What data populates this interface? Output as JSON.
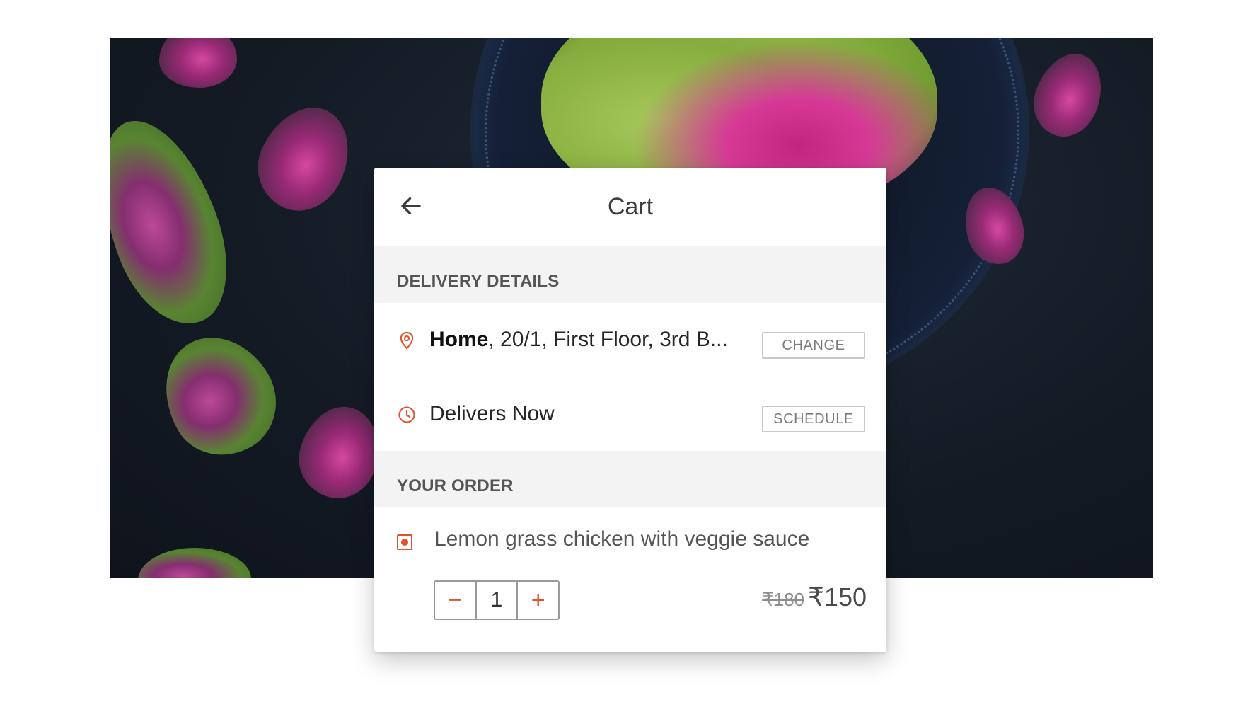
{
  "cart": {
    "title": "Cart",
    "delivery_section": "DELIVERY DETAILS",
    "address_label": "Home",
    "address_rest": ", 20/1, First Floor, 3rd B...",
    "change_label": "CHANGE",
    "delivery_time": "Delivers Now",
    "schedule_label": "SCHEDULE",
    "order_section": "YOUR ORDER",
    "item": {
      "name": "Lemon grass chicken with veggie sauce",
      "quantity": "1",
      "minus": "−",
      "plus": "+",
      "original_price": "₹180",
      "price": "₹150"
    }
  },
  "colors": {
    "accent": "#e0522b",
    "section_bg": "#f3f3f3"
  },
  "icons": {
    "back": "arrow-left-icon",
    "location": "map-pin-icon",
    "time": "clock-icon",
    "food_marker": "non-veg-marker-icon"
  }
}
